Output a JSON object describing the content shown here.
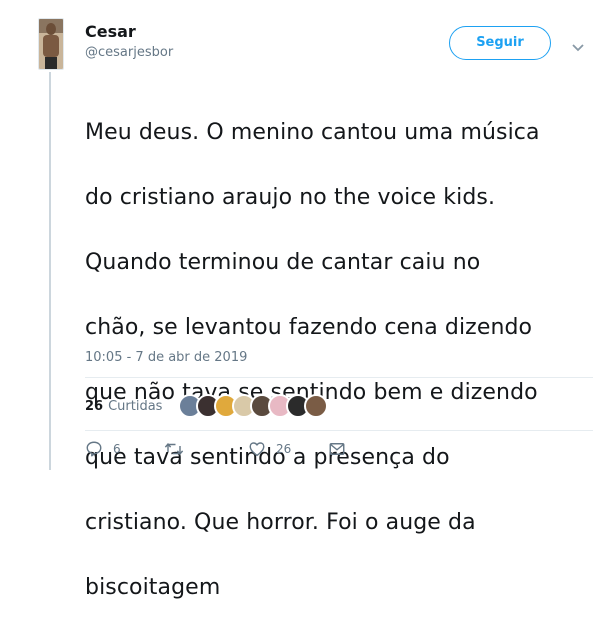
{
  "author": {
    "display_name": "Cesar",
    "handle": "@cesarjesbor"
  },
  "follow_button": {
    "label": "Seguir"
  },
  "tweet": {
    "text_lines": [
      "Meu deus. O menino cantou uma música",
      "do cristiano araujo no the voice kids.",
      "Quando terminou de cantar caiu no",
      "chão, se levantou fazendo cena dizendo",
      "que não tava se sentindo bem e dizendo",
      "que tava sentindo a presença do",
      "cristiano. Que horror. Foi o auge da",
      "biscoitagem"
    ],
    "timestamp": "10:05 - 7 de abr de 2019"
  },
  "likes": {
    "count": "26",
    "label": "Curtidas",
    "avatars": [
      {
        "icon": "avatar-icon",
        "color": "#6b7f99"
      },
      {
        "icon": "avatar-icon",
        "color": "#3b3030"
      },
      {
        "icon": "avatar-icon",
        "color": "#e0a93c"
      },
      {
        "icon": "avatar-icon",
        "color": "#d9c9a8"
      },
      {
        "icon": "avatar-icon",
        "color": "#5a4a3e"
      },
      {
        "icon": "avatar-icon",
        "color": "#e8b9c4"
      },
      {
        "icon": "avatar-icon",
        "color": "#2b2b2b"
      },
      {
        "icon": "avatar-icon",
        "color": "#7a5c45"
      }
    ]
  },
  "actions": {
    "reply_count": "6",
    "retweet_count": "",
    "like_count": "26"
  },
  "colors": {
    "accent": "#1da1f2",
    "text": "#14171a",
    "secondary": "#657786"
  }
}
